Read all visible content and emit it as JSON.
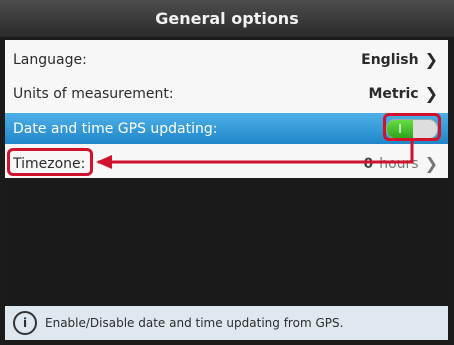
{
  "window": {
    "title": "General options"
  },
  "settings": [
    {
      "label": "Language:",
      "value": "English"
    },
    {
      "label": "Units of measurement:",
      "value": "Metric"
    },
    {
      "label": "Date and time GPS updating:",
      "toggle_state": "on",
      "toggle_glyph": "I"
    },
    {
      "label": "Timezone:",
      "value_num": "0",
      "value_unit": "hours"
    }
  ],
  "footer": {
    "info_glyph": "i",
    "text": "Enable/Disable date and time updating from GPS."
  },
  "icons": {
    "chevron": "chevron-right-icon",
    "info": "info-icon"
  },
  "colors": {
    "selected_row": "#2c92d6",
    "toggle_on": "#3bb523",
    "annotation": "#d1122d"
  }
}
